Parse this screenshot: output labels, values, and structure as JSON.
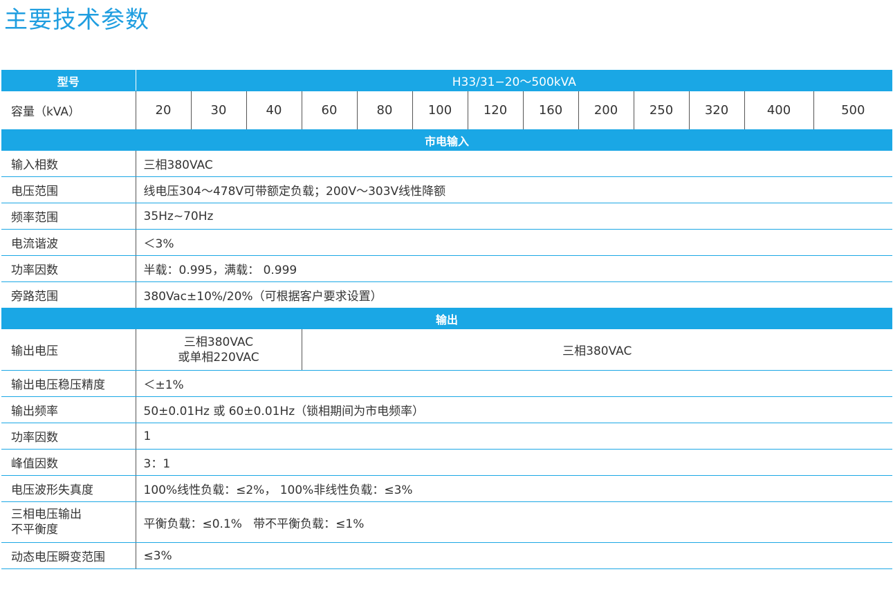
{
  "title": "主要技术参数",
  "header": {
    "model_label": "型号",
    "model_value": "H33/31−20～500kVA"
  },
  "capacity": {
    "label": "容量（kVA）",
    "values": [
      "20",
      "30",
      "40",
      "60",
      "80",
      "100",
      "120",
      "160",
      "200",
      "250",
      "320",
      "400",
      "500"
    ]
  },
  "section_input": "市电输入",
  "input_rows": [
    {
      "label": "输入相数",
      "value": "三相380VAC"
    },
    {
      "label": "电压范围",
      "value": "线电压304～478V可带额定负载；200V～303V线性降额"
    },
    {
      "label": "频率范围",
      "value": "35Hz~70Hz"
    },
    {
      "label": "电流谐波",
      "value": "＜3%"
    },
    {
      "label": "功率因数",
      "value": "半载：0.995，满载： 0.999"
    },
    {
      "label": "旁路范围",
      "value": "380Vac±10%/20%（可根据客户要求设置）"
    }
  ],
  "section_output": "输出",
  "output_voltage": {
    "label": "输出电压",
    "value_small_1": "三相380VAC",
    "value_small_2": "或单相220VAC",
    "value_large": "三相380VAC"
  },
  "output_rows": [
    {
      "label": "输出电压稳压精度",
      "value": "＜±1%"
    },
    {
      "label": "输出频率",
      "value": "50±0.01Hz 或 60±0.01Hz（锁相期间为市电频率）"
    },
    {
      "label": "功率因数",
      "value": "1"
    },
    {
      "label": "峰值因数",
      "value": "3：1"
    },
    {
      "label": "电压波形失真度",
      "value": "100%线性负载：≤2%，  100%非线性负载：≤3%"
    }
  ],
  "unbalance": {
    "label_1": "三相电压输出",
    "label_2": "不平衡度",
    "value": "平衡负载：≤0.1%   带不平衡负载：≤1%"
  },
  "transient": {
    "label": "动态电压瞬变范围",
    "value": "≤3%"
  }
}
